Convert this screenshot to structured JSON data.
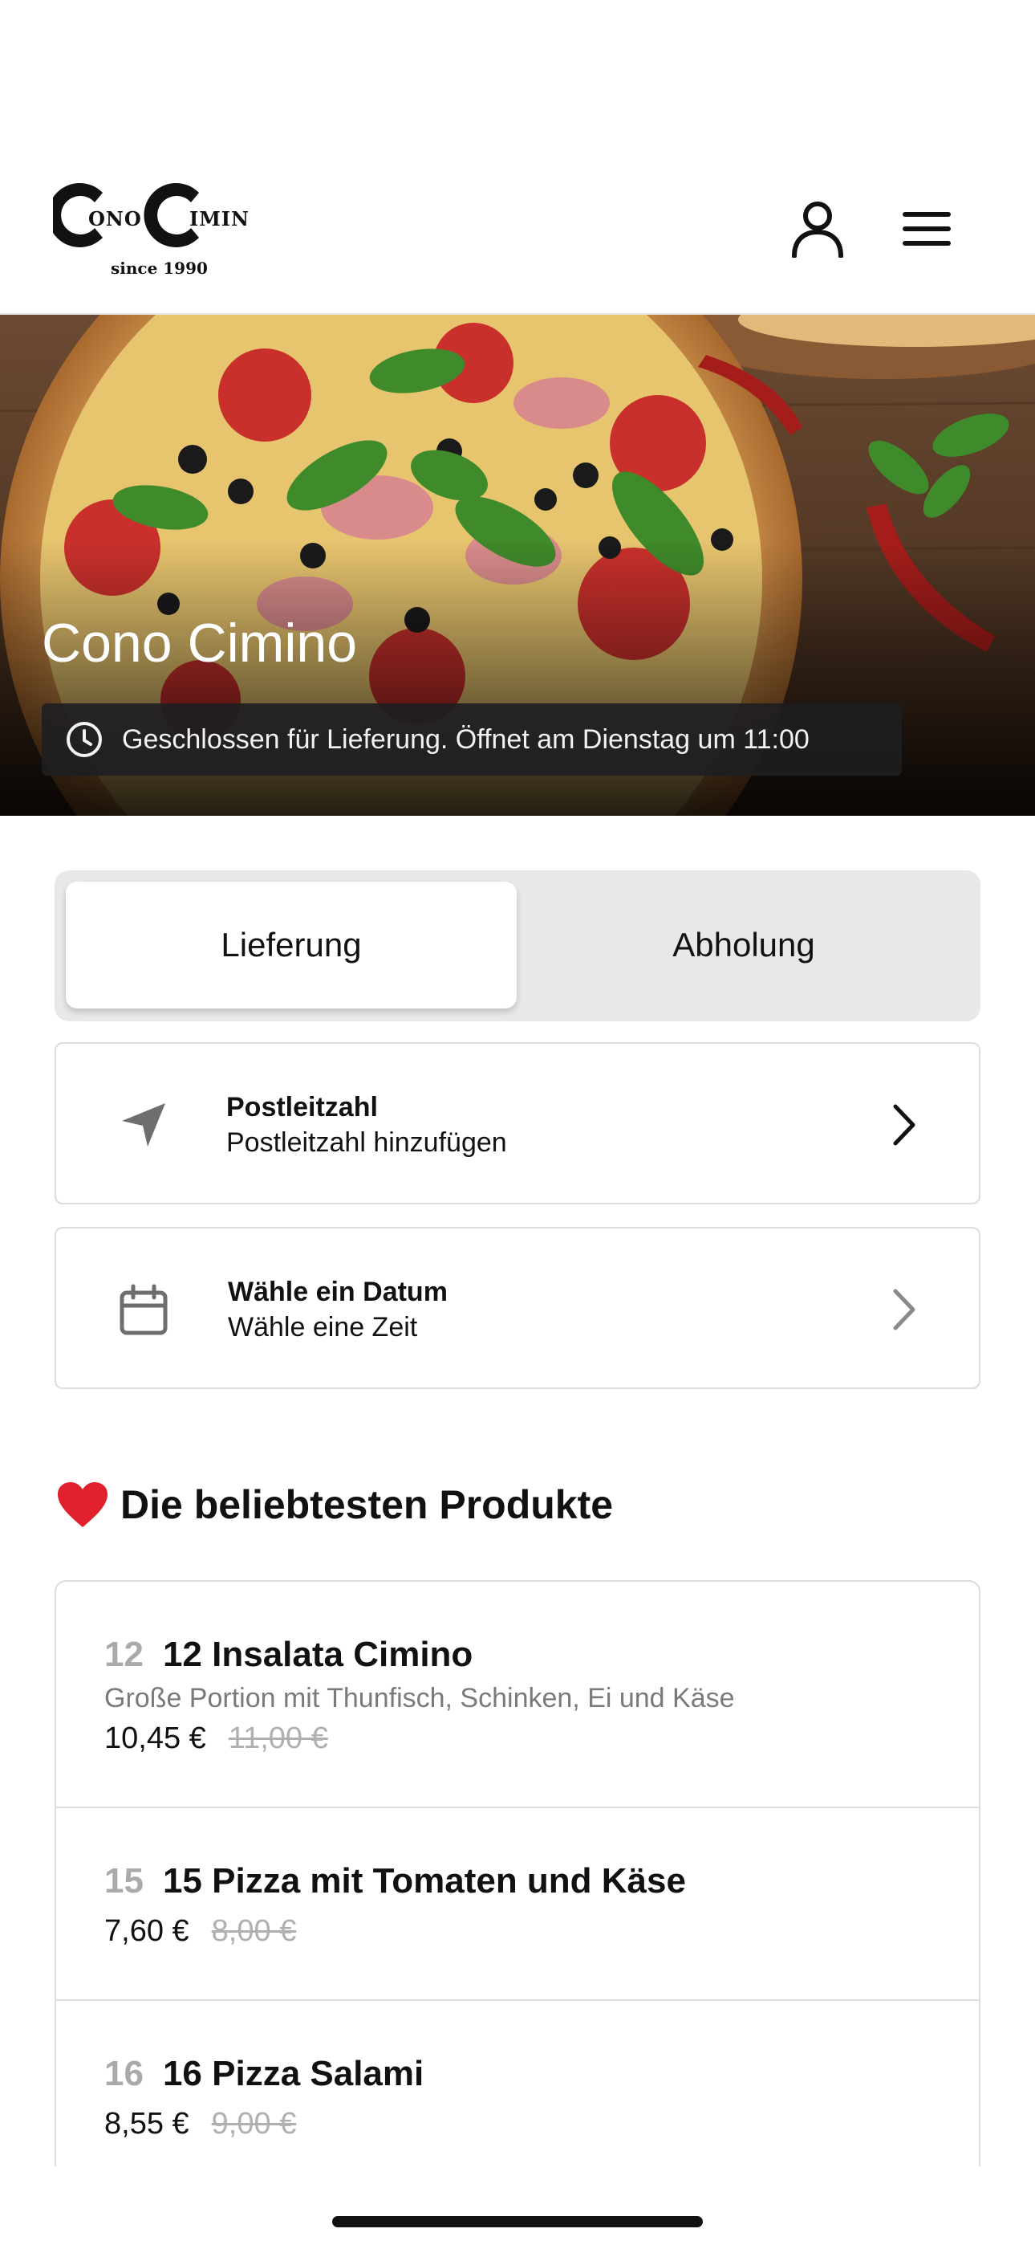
{
  "header": {
    "logo": {
      "text": "Cono Cimin",
      "since": "since 1990"
    },
    "profile_icon": "person-icon",
    "menu_icon": "hamburger-menu-icon"
  },
  "hero": {
    "title": "Cono Cimino",
    "status": "Geschlossen für Lieferung. Öffnet am Dienstag um 11:00",
    "status_icon": "clock-icon"
  },
  "order_mode": {
    "options": [
      "Lieferung",
      "Abholung"
    ],
    "selected": "Lieferung"
  },
  "postcode": {
    "title": "Postleitzahl",
    "subtitle": "Postleitzahl hinzufügen",
    "icon": "location-arrow-icon"
  },
  "schedule": {
    "title": "Wähle ein Datum",
    "subtitle": "Wähle eine Zeit",
    "icon": "calendar-icon"
  },
  "popular": {
    "heading": "Die beliebtesten Produkte",
    "heading_icon": "heart-icon",
    "items": [
      {
        "number": "12",
        "name": "12 Insalata Cimino",
        "description": "Große Portion mit Thunfisch, Schinken, Ei und Käse",
        "price": "10,45 €",
        "old_price": "11,00 €"
      },
      {
        "number": "15",
        "name": "15 Pizza mit Tomaten und Käse",
        "description": "",
        "price": "7,60 €",
        "old_price": "8,00 €"
      },
      {
        "number": "16",
        "name": "16 Pizza Salami",
        "description": "",
        "price": "8,55 €",
        "old_price": "9,00 €"
      }
    ]
  },
  "colors": {
    "status_bg": "#1e1e20",
    "segment_bg": "#e8e8e8",
    "border": "#dcdcdc",
    "muted_text": "#7a7a7a",
    "heart": "#e0202a"
  }
}
